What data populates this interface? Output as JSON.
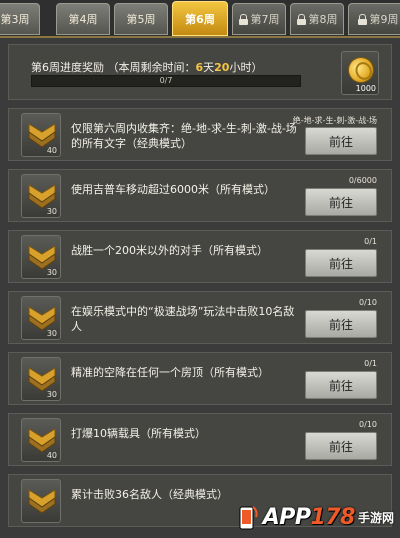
{
  "tabs": [
    {
      "label": "第3周",
      "state": "normal"
    },
    {
      "label": "第4周",
      "state": "normal"
    },
    {
      "label": "第5周",
      "state": "normal"
    },
    {
      "label": "第6周",
      "state": "active"
    },
    {
      "label": "第7周",
      "state": "locked"
    },
    {
      "label": "第8周",
      "state": "locked"
    },
    {
      "label": "第9周",
      "state": "locked"
    }
  ],
  "header": {
    "title_prefix": "第6周进度奖励 （本周剩余时间：",
    "days": "6",
    "days_unit": "天",
    "hours": "20",
    "hours_unit": "小时）",
    "progress_text": "0/7",
    "progress_fraction": 0,
    "reward_count": "1000",
    "reward_icon": "coin-icon"
  },
  "tasks": [
    {
      "text": "仅限第六周内收集齐：绝-地-求-生-刺-激-战-场的所有文字（经典模式）",
      "progress": "绝-地-求-生-刺-激-战-场",
      "level": "40",
      "button": "前往"
    },
    {
      "text": "使用吉普车移动超过6000米（所有模式）",
      "progress": "0/6000",
      "level": "30",
      "button": "前往"
    },
    {
      "text": "战胜一个200米以外的对手（所有模式）",
      "progress": "0/1",
      "level": "30",
      "button": "前往"
    },
    {
      "text": "在娱乐模式中的“极速战场”玩法中击败10名敌人",
      "progress": "0/10",
      "level": "30",
      "button": "前往"
    },
    {
      "text": "精准的空降在任何一个房顶（所有模式）",
      "progress": "0/1",
      "level": "30",
      "button": "前往"
    },
    {
      "text": "打爆10辆载具（所有模式）",
      "progress": "0/10",
      "level": "40",
      "button": "前往"
    },
    {
      "text": "累计击败36名敌人（经典模式）",
      "progress": "",
      "level": "",
      "button": ""
    }
  ],
  "watermark": {
    "brand_prefix": "APP",
    "brand_num": "178",
    "suffix": "手游网"
  },
  "colors": {
    "accent_gold": "#f5c542",
    "panel_bg": "#454642",
    "button_bg": "#c8c8c3"
  }
}
